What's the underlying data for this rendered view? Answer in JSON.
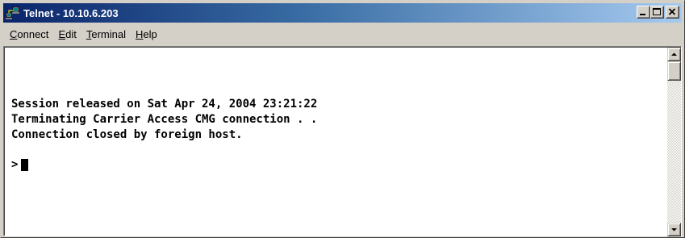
{
  "window": {
    "title": "Telnet - 10.10.6.203",
    "icon": "telnet-app-icon",
    "controls": {
      "minimize_icon": "minimize-icon",
      "maximize_icon": "maximize-icon",
      "close_icon": "close-icon"
    },
    "colors": {
      "titlebar_start": "#0a246a",
      "titlebar_end": "#a6caf0",
      "face": "#d4d0c8",
      "terminal_bg": "#ffffff",
      "terminal_fg": "#000000"
    }
  },
  "menubar": {
    "items": [
      {
        "label_first": "C",
        "label_rest": "onnect"
      },
      {
        "label_first": "E",
        "label_rest": "dit"
      },
      {
        "label_first": "T",
        "label_rest": "erminal"
      },
      {
        "label_first": "H",
        "label_rest": "elp"
      }
    ]
  },
  "terminal": {
    "lines": [
      "Session released on Sat Apr 24, 2004 23:21:22",
      "Terminating Carrier Access CMG connection . .",
      "Connection closed by foreign host."
    ],
    "prompt": ">"
  },
  "scrollbar": {
    "up_icon": "arrow-up-icon",
    "down_icon": "arrow-down-icon"
  }
}
